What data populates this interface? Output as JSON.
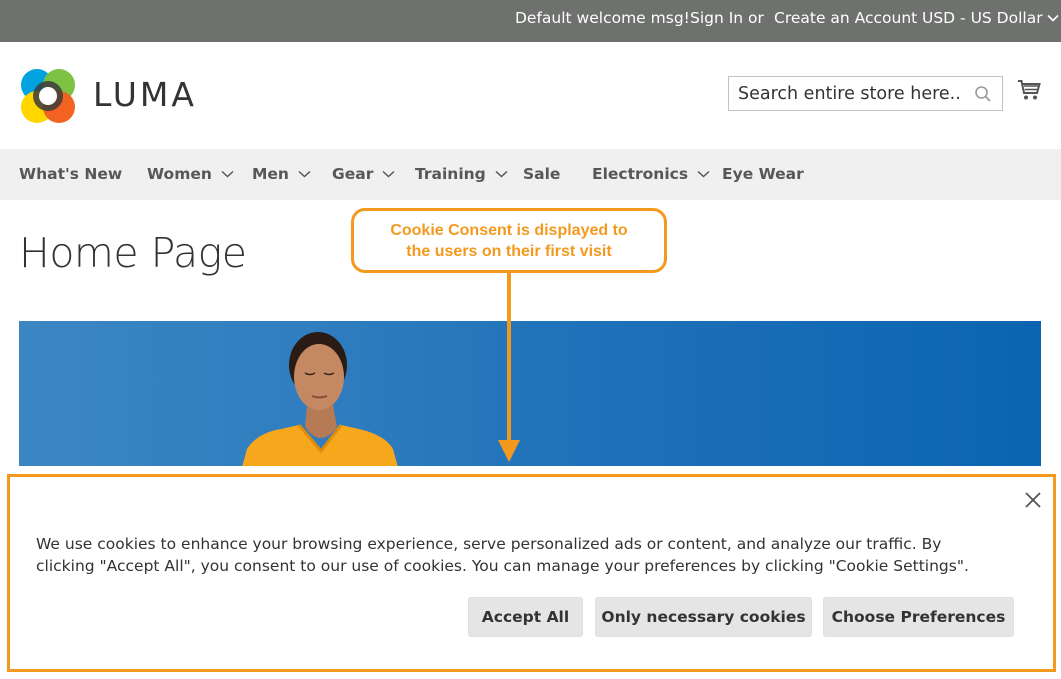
{
  "topbar": {
    "welcome": "Default welcome msg!",
    "sign_in": "Sign In",
    "or": "or",
    "create_account": "Create an Account",
    "currency": "USD - US Dollar"
  },
  "header": {
    "logo_text": "LUMA",
    "search_placeholder": "Search entire store here..."
  },
  "nav": {
    "items": [
      {
        "label": "What's New",
        "has_dropdown": false
      },
      {
        "label": "Women",
        "has_dropdown": true
      },
      {
        "label": "Men",
        "has_dropdown": true
      },
      {
        "label": "Gear",
        "has_dropdown": true
      },
      {
        "label": "Training",
        "has_dropdown": true
      },
      {
        "label": "Sale",
        "has_dropdown": false
      },
      {
        "label": "Electronics",
        "has_dropdown": true
      },
      {
        "label": "Eye Wear",
        "has_dropdown": false
      }
    ]
  },
  "page": {
    "title": "Home Page"
  },
  "annotation": {
    "line1": "Cookie Consent is displayed to",
    "line2": "the users on their first visit"
  },
  "cookie": {
    "text": "We use cookies to enhance your browsing experience, serve personalized ads or content, and analyze our traffic. By clicking \"Accept All\", you consent to our use of cookies. You can manage your preferences by clicking \"Cookie Settings\".",
    "accept_all": "Accept All",
    "necessary": "Only necessary cookies",
    "preferences": "Choose Preferences"
  },
  "colors": {
    "topbar": "#6e716e",
    "nav_bg": "#f0f0f0",
    "annotation": "#f39a1e",
    "button_bg": "#e5e5e5"
  }
}
